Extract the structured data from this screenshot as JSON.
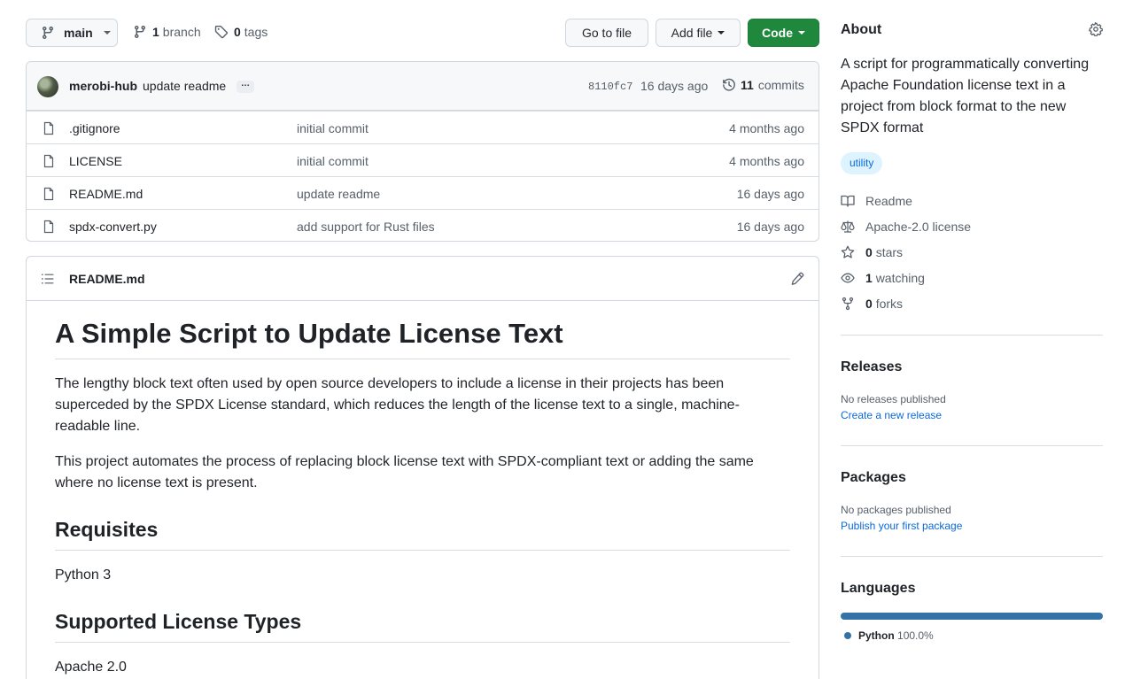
{
  "toolbar": {
    "branch": "main",
    "branch_count": "1",
    "branch_label": "branch",
    "tag_count": "0",
    "tag_label": "tags",
    "goto_file": "Go to file",
    "add_file": "Add file",
    "code": "Code"
  },
  "commit": {
    "author": "merobi-hub",
    "message": "update readme",
    "ellipsis": "…",
    "sha": "8110fc7",
    "time": "16 days ago",
    "count": "11",
    "count_label": "commits"
  },
  "files": [
    {
      "name": ".gitignore",
      "message": "initial commit",
      "age": "4 months ago"
    },
    {
      "name": "LICENSE",
      "message": "initial commit",
      "age": "4 months ago"
    },
    {
      "name": "README.md",
      "message": "update readme",
      "age": "16 days ago"
    },
    {
      "name": "spdx-convert.py",
      "message": "add support for Rust files",
      "age": "16 days ago"
    }
  ],
  "readme": {
    "filename": "README.md",
    "h1": "A Simple Script to Update License Text",
    "p1": "The lengthy block text often used by open source developers to include a license in their projects has been superceded by the SPDX License standard, which reduces the length of the license text to a single, machine-readable line.",
    "p2": "This project automates the process of replacing block license text with SPDX-compliant text or adding the same where no license text is present.",
    "h2_requisites": "Requisites",
    "requisites": "Python 3",
    "h2_types": "Supported License Types",
    "types": "Apache 2.0"
  },
  "sidebar": {
    "about_title": "About",
    "description": "A script for programmatically converting Apache Foundation license text in a project from block format to the new SPDX format",
    "topic": "utility",
    "readme": "Readme",
    "license": "Apache-2.0 license",
    "stars_count": "0",
    "stars_label": "stars",
    "watching_count": "1",
    "watching_label": "watching",
    "forks_count": "0",
    "forks_label": "forks",
    "releases_title": "Releases",
    "releases_none": "No releases published",
    "releases_link": "Create a new release",
    "packages_title": "Packages",
    "packages_none": "No packages published",
    "packages_link": "Publish your first package",
    "languages_title": "Languages",
    "language_name": "Python",
    "language_pct": "100.0%",
    "language_color": "#3572a5"
  },
  "colors": {
    "code_button": "#1f883d",
    "link": "#0969da",
    "topic_bg": "#ddf4ff"
  }
}
